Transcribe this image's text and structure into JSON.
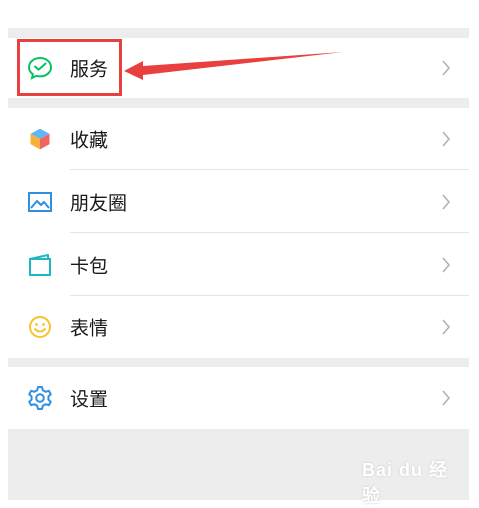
{
  "menu": {
    "service": {
      "label": "服务",
      "icon": "wechat-pay-icon"
    },
    "favorites": {
      "label": "收藏",
      "icon": "cube-icon"
    },
    "moments": {
      "label": "朋友圈",
      "icon": "image-icon"
    },
    "cards": {
      "label": "卡包",
      "icon": "wallet-icon"
    },
    "stickers": {
      "label": "表情",
      "icon": "smiley-icon"
    },
    "settings": {
      "label": "设置",
      "icon": "gear-icon"
    }
  },
  "annotation": {
    "color": "#e8403e"
  },
  "watermark": {
    "text": "Bai du 经验"
  },
  "colors": {
    "background": "#ededed",
    "row": "#ffffff",
    "text": "#191919",
    "wechat_green": "#07c160",
    "chevron": "#b2b2b2"
  }
}
